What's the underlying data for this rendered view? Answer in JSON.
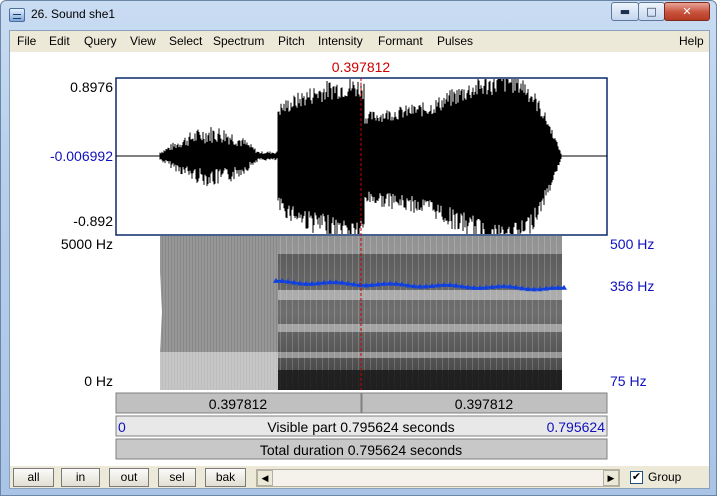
{
  "window": {
    "title": "26. Sound she1",
    "min_glyph": "▬",
    "max_glyph": "□",
    "close_glyph": "✕"
  },
  "menu": {
    "items": [
      "File",
      "Edit",
      "Query",
      "View",
      "Select",
      "Spectrum",
      "Pitch",
      "Intensity",
      "Formant",
      "Pulses"
    ],
    "help": "Help"
  },
  "editor": {
    "cursor_time": "0.397812",
    "waveform_labels": {
      "top": "0.8976",
      "middle": "-0.006992",
      "bottom": "-0.892"
    },
    "spectrogram_labels": {
      "top": "5000 Hz",
      "bottom": "0 Hz"
    },
    "pitch_labels": {
      "top": "500 Hz",
      "middle": "356 Hz",
      "bottom": "75 Hz"
    },
    "segment_left": "0.397812",
    "segment_right": "0.397812",
    "visible_start": "0",
    "visible_part": "Visible part 0.795624 seconds",
    "visible_end": "0.795624",
    "total_duration": "Total duration 0.795624 seconds",
    "colors": {
      "cursor": "#cc0000",
      "axis_blue": "#1010c0",
      "pitch": "#1040e0",
      "waveform": "#000000",
      "frame": "#0a2a6a"
    }
  },
  "controls": {
    "buttons": [
      "all",
      "in",
      "out",
      "sel",
      "bak"
    ],
    "group_label": "Group",
    "group_checked": true,
    "check_glyph": "✔",
    "scroll_left_glyph": "◀",
    "scroll_right_glyph": "▶"
  }
}
